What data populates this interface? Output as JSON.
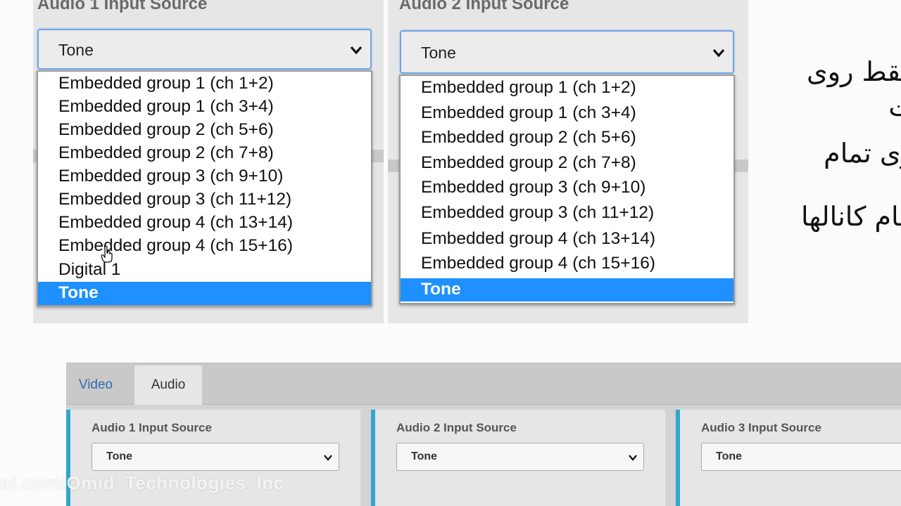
{
  "zoom": {
    "audio1": {
      "title": "Audio 1 Input Source",
      "selected": "Tone",
      "options": [
        "Embedded group 1 (ch 1+2)",
        "Embedded group 1 (ch 3+4)",
        "Embedded group 2 (ch 5+6)",
        "Embedded group 2 (ch 7+8)",
        "Embedded group 3 (ch 9+10)",
        "Embedded group 3 (ch 11+12)",
        "Embedded group 4 (ch 13+14)",
        "Embedded group 4 (ch 15+16)",
        "Digital 1",
        "Tone"
      ]
    },
    "audio2": {
      "title": "Audio 2 Input Source",
      "selected": "Tone",
      "options": [
        "Embedded group 1 (ch 1+2)",
        "Embedded group 1 (ch 3+4)",
        "Embedded group 2 (ch 5+6)",
        "Embedded group 2 (ch 7+8)",
        "Embedded group 3 (ch 9+10)",
        "Embedded group 3 (ch 11+12)",
        "Embedded group 4 (ch 13+14)",
        "Embedded group 4 (ch 15+16)",
        "Tone"
      ]
    }
  },
  "annotation": {
    "lines": [
      "فقط روی",
      "ت",
      "وی تمام",
      "،",
      "مام کانالها"
    ]
  },
  "tabs": {
    "video": "Video",
    "audio": "Audio"
  },
  "cards": [
    {
      "title": "Audio 1 Input Source",
      "value": "Tone"
    },
    {
      "title": "Audio 2 Input Source",
      "value": "Tone"
    },
    {
      "title": "Audio 3 Input Source",
      "value": "Tone"
    }
  ],
  "watermark": "at.com/Omid_Technologies_Inc",
  "colors": {
    "highlight": "#1e90ff",
    "tab_link": "#2f6db4",
    "card_accent": "#30a7cc"
  }
}
